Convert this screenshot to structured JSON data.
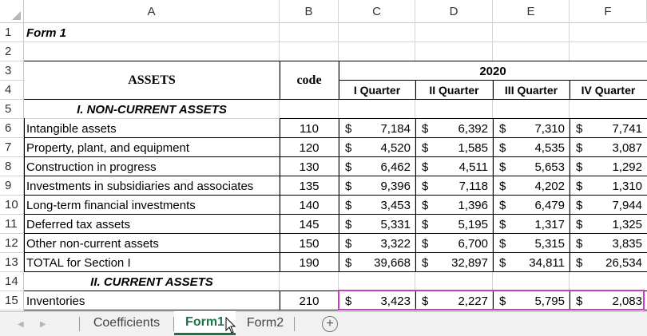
{
  "columns": [
    "A",
    "B",
    "C",
    "D",
    "E",
    "F"
  ],
  "rows": [
    "1",
    "2",
    "3",
    "4",
    "5",
    "6",
    "7",
    "8",
    "9",
    "10",
    "11",
    "12",
    "13",
    "14",
    "15"
  ],
  "form_title": "Form 1",
  "header": {
    "assets": "ASSETS",
    "code": "code",
    "year": "2020",
    "quarters": [
      "I Quarter",
      "II Quarter",
      "III Quarter",
      "IV Quarter"
    ]
  },
  "section1": "I. NON-CURRENT ASSETS",
  "section2": "II. CURRENT ASSETS",
  "currency": "$",
  "items": [
    {
      "name": "Intangible assets",
      "code": "110",
      "q": [
        "7,184",
        "6,392",
        "7,310",
        "7,741"
      ]
    },
    {
      "name": "Property, plant, and equipment",
      "code": "120",
      "q": [
        "4,520",
        "1,585",
        "4,535",
        "3,087"
      ]
    },
    {
      "name": "Construction in progress",
      "code": "130",
      "q": [
        "6,462",
        "4,511",
        "5,653",
        "1,292"
      ]
    },
    {
      "name": "Investments in subsidiaries and associates",
      "code": "135",
      "q": [
        "9,396",
        "7,118",
        "4,202",
        "1,310"
      ]
    },
    {
      "name": "Long-term financial investments",
      "code": "140",
      "q": [
        "3,453",
        "1,396",
        "6,479",
        "7,944"
      ]
    },
    {
      "name": "Deferred tax assets",
      "code": "145",
      "q": [
        "5,331",
        "5,195",
        "1,317",
        "1,325"
      ]
    },
    {
      "name": "Other non-current assets",
      "code": "150",
      "q": [
        "3,322",
        "6,700",
        "5,315",
        "3,835"
      ]
    },
    {
      "name": "TOTAL for Section I",
      "code": "190",
      "q": [
        "39,668",
        "32,897",
        "34,811",
        "26,534"
      ]
    }
  ],
  "inventories": {
    "name": "Inventories",
    "code": "210",
    "q": [
      "3,423",
      "2,227",
      "5,795",
      "2,083"
    ]
  },
  "tabs": {
    "coefficients": "Coefficients",
    "form1": "Form1",
    "form2": "Form2",
    "add": "+"
  },
  "accent_color": "#217346",
  "selection_color": "#c839c8"
}
